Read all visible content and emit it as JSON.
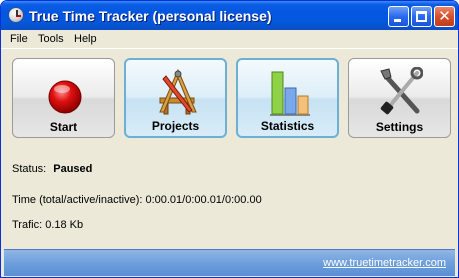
{
  "window": {
    "title": "True Time Tracker (personal license)"
  },
  "menu": {
    "file": "File",
    "tools": "Tools",
    "help": "Help"
  },
  "toolbar": {
    "start": "Start",
    "projects": "Projects",
    "statistics": "Statistics",
    "settings": "Settings"
  },
  "status": {
    "label": "Status:",
    "value": "Paused"
  },
  "time": {
    "text": "Time (total/active/inactive): 0:00.01/0:00.01/0:00.00"
  },
  "trafic": {
    "text": "Trafic: 0.18 Kb"
  },
  "footer": {
    "link": "www.truetimetracker.com"
  },
  "colors": {
    "titlebar": "#0456e0",
    "footer": "#6e9fdc",
    "active_button_border": "#6cb0d6",
    "record_red": "#e01010"
  },
  "icons": {
    "start": "record-icon",
    "projects": "drafting-tools-icon",
    "statistics": "bar-chart-icon",
    "settings": "wrench-screwdriver-icon"
  }
}
